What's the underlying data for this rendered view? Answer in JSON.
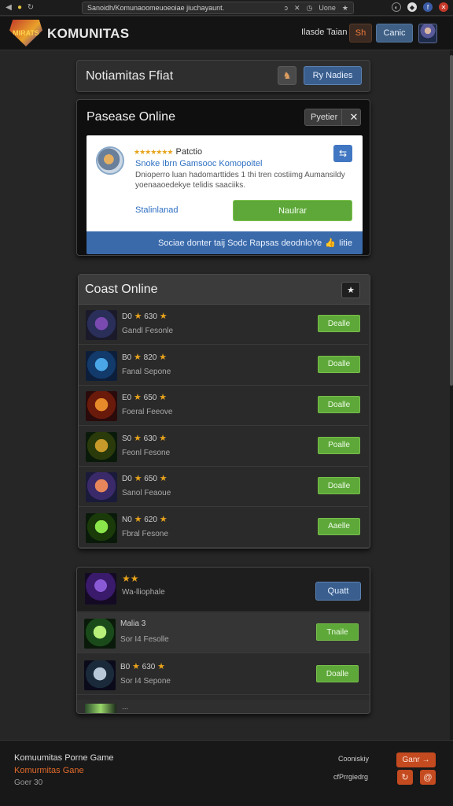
{
  "browser": {
    "url": "Sanoidh/Komunaoomeuoeoiae jiuchayaunt.",
    "url_right": "Uone"
  },
  "header": {
    "brand": "KOMUNITAS",
    "logo_text": "MIRATS",
    "nav_text": "Ilasde Taian",
    "sh_label": "Sh",
    "cancel_label": "Canic"
  },
  "notif_bar": {
    "title": "Notiamitas Ffiat",
    "button": "Ry Nadies"
  },
  "online_panel": {
    "title": "Pasease Online",
    "select_label": "Pyetier",
    "card": {
      "stars": "★★★★★★★",
      "name": "Patctio",
      "subtitle": "Snoke Ibrn Gamsooc Komopoitel",
      "description": "Dnioperro luan hadomarttides 1 thi tren costiimg Aumansildy yoenaaoedekye telidis saaciiks.",
      "link": "Stalinlanad",
      "go_button": "Naulrar"
    },
    "footer_text": "Sociae donter taij Sodc Rapsas deodnloYe",
    "footer_tail": "Iitie"
  },
  "coast_panel": {
    "title": "Coast Online",
    "rows": [
      {
        "count": "D0",
        "score": "630",
        "name": "Gandl Fesonle",
        "button": "Dealle",
        "colors": [
          "#2a2f5a",
          "#7a4ab0",
          "#1a1a2a"
        ]
      },
      {
        "count": "B0",
        "score": "820",
        "name": "Fanal Sepone",
        "button": "Doalle",
        "colors": [
          "#123a6a",
          "#4aa6e6",
          "#0c1e3a"
        ]
      },
      {
        "count": "E0",
        "score": "650",
        "name": "Foeral Feeove",
        "button": "Doalle",
        "colors": [
          "#6a1a0a",
          "#e68a2a",
          "#2a0a0a"
        ]
      },
      {
        "count": "S0",
        "score": "630",
        "name": "Feonl Fesone",
        "button": "Poalle",
        "colors": [
          "#2a3a0a",
          "#c89a2a",
          "#0a1a0a"
        ]
      },
      {
        "count": "D0",
        "score": "650",
        "name": "Sanol Feaoue",
        "button": "Doalle",
        "colors": [
          "#3a2a6a",
          "#e6865a",
          "#1a1a3a"
        ]
      },
      {
        "count": "N0",
        "score": "620",
        "name": "Fbral Fesone",
        "button": "Aaelle",
        "colors": [
          "#1a3a0a",
          "#8ae64a",
          "#0a1a0a"
        ]
      }
    ]
  },
  "friends_panel": {
    "stars": "★★",
    "subtitle": "Wa-lliophale",
    "button": "Quatt",
    "rows": [
      {
        "count": "Malia",
        "score": "3",
        "name": "Sor I4 Fesolle",
        "button": "Tnaile",
        "colors": [
          "#1a4a1a",
          "#b8f07a",
          "#0a1a0a"
        ],
        "stars": false
      },
      {
        "count": "B0",
        "score": "630",
        "name": "Sor I4 Sepone",
        "button": "Doalle",
        "colors": [
          "#1a2a3a",
          "#b8c8d8",
          "#0a0a1a"
        ],
        "stars": true
      }
    ],
    "partial_text": "..."
  },
  "footer": {
    "line1": "Komuumitas Porne Game",
    "line2": "Komurmitas Gane",
    "line3": "Goer 30",
    "right1": "Cooniskiy",
    "right2": "cfPrrgiedrg",
    "cta": "Ganr →"
  }
}
